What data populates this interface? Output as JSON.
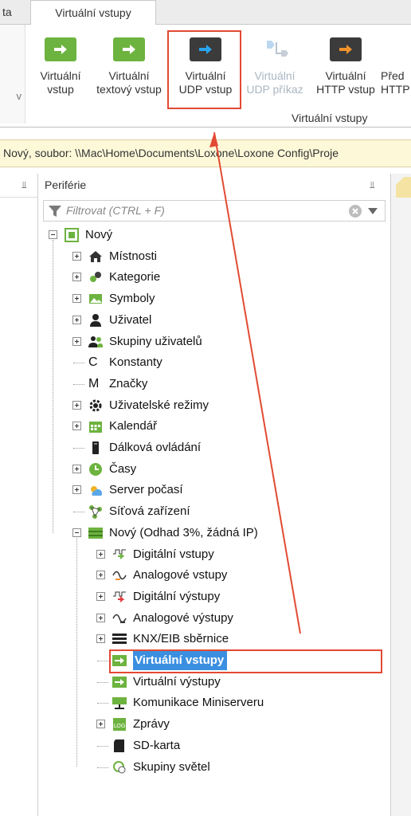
{
  "ribbon_tabs": {
    "left_partial": "ta",
    "active": "Virtuální vstupy"
  },
  "ribbon": {
    "left_stub_char": "v",
    "buttons": [
      {
        "line1": "Virtuální",
        "line2": "vstup",
        "icon": "virtual-input-icon",
        "enabled": true
      },
      {
        "line1": "Virtuální",
        "line2": "textový vstup",
        "icon": "virtual-text-input-icon",
        "enabled": true
      },
      {
        "line1": "Virtuální",
        "line2": "UDP vstup",
        "icon": "virtual-udp-input-icon",
        "enabled": true
      },
      {
        "line1": "Virtuální",
        "line2": "UDP příkaz",
        "icon": "virtual-udp-command-icon",
        "enabled": false
      },
      {
        "line1": "Virtuální",
        "line2": "HTTP vstup",
        "icon": "virtual-http-input-icon",
        "enabled": true
      },
      {
        "line1": "Před",
        "line2": "HTTP",
        "icon": "http-preset-icon",
        "enabled": true
      }
    ],
    "group_label": "Virtuální vstupy"
  },
  "pathbar": {
    "text": "Nový, soubor: \\\\Mac\\Home\\Documents\\Loxone\\Loxone Config\\Proje"
  },
  "panels": {
    "periphery_title": "Periférie",
    "pin_glyph": "⫫",
    "filter_placeholder": "Filtrovat (CTRL + F)"
  },
  "tree": {
    "root": "Nový",
    "level1": [
      {
        "label": "Místnosti",
        "icon": "house-icon",
        "expandable": true
      },
      {
        "label": "Kategorie",
        "icon": "category-icon",
        "expandable": true
      },
      {
        "label": "Symboly",
        "icon": "image-icon",
        "expandable": true
      },
      {
        "label": "Uživatel",
        "icon": "user-icon",
        "expandable": true
      },
      {
        "label": "Skupiny uživatelů",
        "icon": "user-group-icon",
        "expandable": true
      },
      {
        "label": "Konstanty",
        "icon": "constant-icon",
        "expandable": false,
        "glyph": "C"
      },
      {
        "label": "Značky",
        "icon": "marker-icon",
        "expandable": false,
        "glyph": "M"
      },
      {
        "label": "Uživatelské režimy",
        "icon": "gear-icon",
        "expandable": true
      },
      {
        "label": "Kalendář",
        "icon": "calendar-icon",
        "expandable": true
      },
      {
        "label": "Dálková ovládání",
        "icon": "remote-icon",
        "expandable": false
      },
      {
        "label": "Časy",
        "icon": "clock-icon",
        "expandable": true
      },
      {
        "label": "Server počasí",
        "icon": "weather-icon",
        "expandable": true
      },
      {
        "label": "Síťová zařízení",
        "icon": "network-icon",
        "expandable": false
      },
      {
        "label": "Nový (Odhad 3%, žádná IP)",
        "icon": "miniserver-icon",
        "expandable": true,
        "expanded": true
      }
    ],
    "level2": [
      {
        "label": "Digitální vstupy",
        "icon": "digital-input-icon",
        "expandable": true
      },
      {
        "label": "Analogové vstupy",
        "icon": "analog-input-icon",
        "expandable": true
      },
      {
        "label": "Digitální výstupy",
        "icon": "digital-output-icon",
        "expandable": true
      },
      {
        "label": "Analogové výstupy",
        "icon": "analog-output-icon",
        "expandable": true
      },
      {
        "label": "KNX/EIB sběrnice",
        "icon": "knx-bus-icon",
        "expandable": true
      },
      {
        "label": "Virtuální vstupy",
        "icon": "virtual-input-icon",
        "expandable": false,
        "selected": true
      },
      {
        "label": "Virtuální výstupy",
        "icon": "virtual-output-icon",
        "expandable": false
      },
      {
        "label": "Komunikace Miniserveru",
        "icon": "miniserver-comm-icon",
        "expandable": false
      },
      {
        "label": "Zprávy",
        "icon": "log-icon",
        "expandable": true
      },
      {
        "label": "SD-karta",
        "icon": "sd-card-icon",
        "expandable": false
      },
      {
        "label": "Skupiny světel",
        "icon": "light-group-icon",
        "expandable": false
      }
    ]
  },
  "colors": {
    "accent_green": "#6db33f",
    "selection_blue": "#3b8fe0",
    "annotation_red": "#e24a33",
    "path_bg": "#fdf8d8"
  }
}
